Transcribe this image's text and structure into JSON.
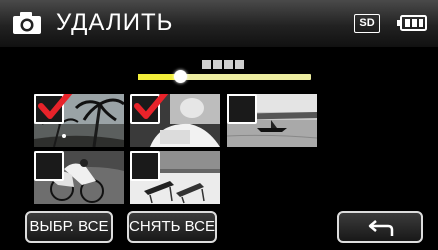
{
  "header": {
    "title": "УДАЛИТЬ",
    "media_badge": "SD",
    "mode_icon": "camera-icon",
    "battery_icon": "battery-icon"
  },
  "scroll": {
    "page_markers": 4,
    "position_fraction": 0.24
  },
  "thumbnails": [
    {
      "scene": "palm-trees-beach",
      "checked": true
    },
    {
      "scene": "person-reading",
      "checked": true
    },
    {
      "scene": "lake-boat",
      "checked": false
    },
    {
      "scene": "cyclists",
      "checked": false
    },
    {
      "scene": "beach-chairs",
      "checked": false
    }
  ],
  "buttons": {
    "select_all": "ВЫБР. ВСЕ",
    "deselect_all": "СНЯТЬ ВСЕ",
    "back_icon": "return-arrow-icon"
  },
  "colors": {
    "check": "#e8232a",
    "slider": "#f2ee3a",
    "header": "#2a2a2a"
  }
}
